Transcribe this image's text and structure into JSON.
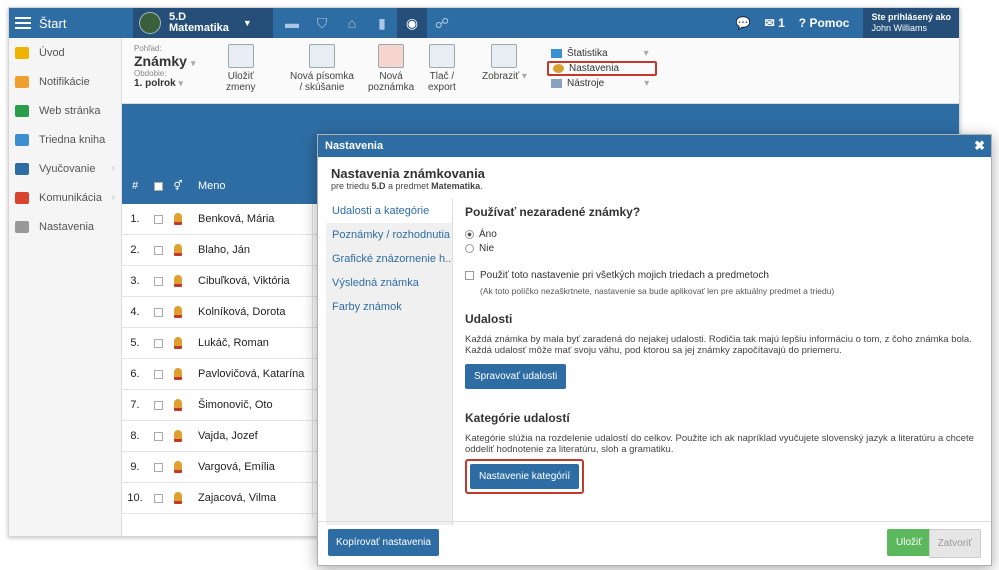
{
  "topbar": {
    "start_label": "Štart",
    "class_code": "5.D",
    "class_subject": "Matematika",
    "messages_count": "1",
    "help_label": "Pomoc",
    "signed_in_label": "Ste prihlásený ako",
    "user_name": "John Williams"
  },
  "sidebar": {
    "items": [
      {
        "label": "Úvod",
        "icon": "star-icon"
      },
      {
        "label": "Notifikácie",
        "icon": "envelope-icon"
      },
      {
        "label": "Web stránka",
        "icon": "home-icon"
      },
      {
        "label": "Triedna kniha",
        "icon": "book-icon"
      },
      {
        "label": "Vyučovanie",
        "icon": "open-book-icon"
      },
      {
        "label": "Komunikácia",
        "icon": "chat-icon"
      },
      {
        "label": "Nastavenia",
        "icon": "gear-icon"
      }
    ]
  },
  "toolbar": {
    "view_label": "Pohľad:",
    "view_value": "Známky",
    "period_label": "Obdobie:",
    "period_value": "1. polrok",
    "save_label_1": "Uložiť",
    "save_label_2": "zmeny",
    "new_test_1": "Nová písomka",
    "new_test_2": "/ skúšanie",
    "new_note_1": "Nová",
    "new_note_2": "poznámka",
    "print_1": "Tlač /",
    "print_2": "export",
    "show_label": "Zobraziť",
    "menu": {
      "statistics": "Štatistika",
      "settings": "Nastavenia",
      "tools": "Nástroje"
    }
  },
  "table": {
    "col_num": "#",
    "col_name": "Meno",
    "rows": [
      {
        "num": "1.",
        "name": "Benková, Mária"
      },
      {
        "num": "2.",
        "name": "Blaho, Ján"
      },
      {
        "num": "3.",
        "name": "Cibuľková, Viktória"
      },
      {
        "num": "4.",
        "name": "Kolníková, Dorota"
      },
      {
        "num": "5.",
        "name": "Lukáč, Roman"
      },
      {
        "num": "6.",
        "name": "Pavlovičová, Katarína"
      },
      {
        "num": "7.",
        "name": "Šimonovič, Oto"
      },
      {
        "num": "8.",
        "name": "Vajda, Jozef"
      },
      {
        "num": "9.",
        "name": "Vargová, Emília"
      },
      {
        "num": "10.",
        "name": "Zajacová, Vilma"
      }
    ]
  },
  "dialog": {
    "title": "Nastavenia",
    "heading": "Nastavenia známkovania",
    "sub_prefix": "pre triedu ",
    "sub_class": "5.D",
    "sub_mid": " a predmet ",
    "sub_subject": "Matematika",
    "sub_end": ".",
    "tabs": [
      "Udalosti a kategórie",
      "Poznámky / rozhodnutia",
      "Grafické znázornenie h...",
      "Výsledná známka",
      "Farby známok"
    ],
    "q_unassigned": "Používať nezaradené známky?",
    "opt_yes": "Áno",
    "opt_no": "Nie",
    "apply_all": "Použiť toto nastavenie pri všetkých mojich triedach a predmetoch",
    "apply_note": "(Ak toto políčko nezaškrtnete, nastavenie sa bude aplikovať len pre aktuálny predmet a triedu)",
    "events_title": "Udalosti",
    "events_text": "Každá známka by mala byť zaradená do nejakej udalosti. Rodičia tak majú lepšiu informáciu o tom, z čoho známka bola. Každá udalosť môže mať svoju váhu, pod ktorou sa jej známky započítavajú do priemeru.",
    "manage_events": "Spravovať udalosti",
    "categories_title": "Kategórie udalostí",
    "categories_text": "Kategórie slúžia na rozdelenie udalostí do celkov. Použite ich ak napríklad vyučujete slovenský jazyk a literatúru a chcete oddeliť hodnotenie za literatúru, sloh a gramatiku.",
    "categories_button": "Nastavenie kategórií",
    "copy_button": "Kopírovať nastavenia",
    "save_button": "Uložiť",
    "close_button": "Zatvoriť"
  },
  "colors": {
    "primary": "#2e6da4",
    "dark": "#254f78",
    "success": "#5cb85c",
    "highlight": "#c0392b"
  }
}
